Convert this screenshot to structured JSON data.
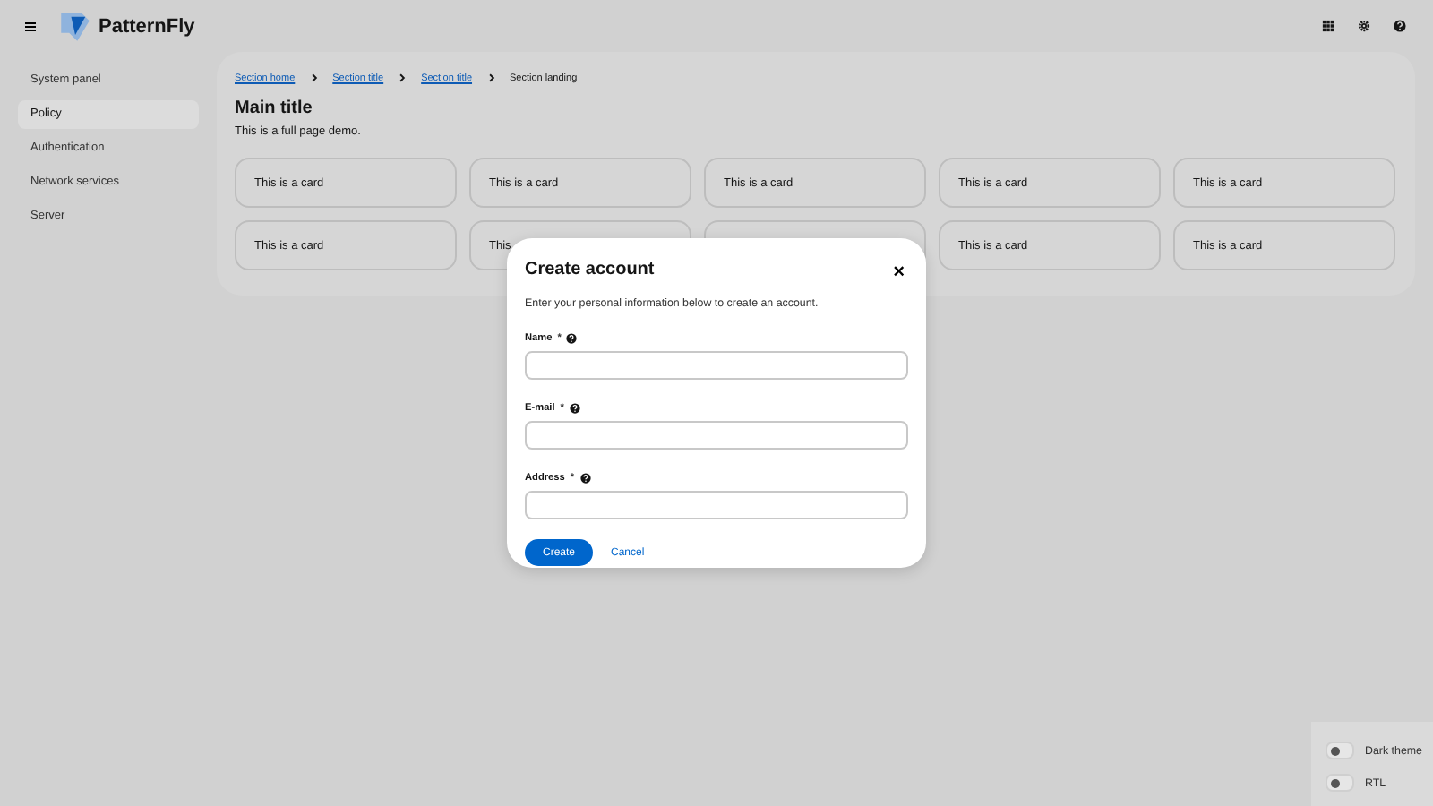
{
  "header": {
    "logo": "PatternFly"
  },
  "sidebar": {
    "items": [
      {
        "label": "System panel",
        "selected": false
      },
      {
        "label": "Policy",
        "selected": true
      },
      {
        "label": "Authentication",
        "selected": false
      },
      {
        "label": "Network services",
        "selected": false
      },
      {
        "label": "Server",
        "selected": false
      }
    ]
  },
  "breadcrumb": [
    {
      "label": "Section home",
      "kind": "link"
    },
    {
      "label": "Section title",
      "kind": "link"
    },
    {
      "label": "Section title",
      "kind": "link"
    },
    {
      "label": "Section landing",
      "kind": "current"
    }
  ],
  "main": {
    "title": "Main title",
    "description": "This is a full page demo."
  },
  "cards": [
    {
      "kind": "text",
      "label": "This is a card"
    },
    {
      "kind": "text",
      "label": "This is a card"
    },
    {
      "kind": "text",
      "label": "This is a card"
    },
    {
      "kind": "text",
      "label": "This is a card"
    },
    {
      "kind": "text",
      "label": "This is a card"
    },
    {
      "kind": "text",
      "label": "This is a card"
    },
    {
      "kind": "text",
      "label": "This"
    },
    {
      "kind": "covered"
    },
    {
      "kind": "text",
      "label": "This is a card"
    },
    {
      "kind": "text",
      "label": "This is a card"
    }
  ],
  "modal": {
    "title": "Create account",
    "close": "×",
    "description": "Enter your personal information below to create an account.",
    "fields": [
      {
        "label": "Name",
        "required_mark": "*"
      },
      {
        "label": "E-mail",
        "required_mark": "*"
      },
      {
        "label": "Address",
        "required_mark": "*"
      }
    ],
    "buttons": [
      {
        "label": "Create",
        "kind": "primary"
      },
      {
        "label": "Cancel",
        "kind": "link"
      }
    ]
  },
  "settings": [
    {
      "label": "Dark theme",
      "on": false
    },
    {
      "label": "RTL",
      "on": false
    }
  ]
}
